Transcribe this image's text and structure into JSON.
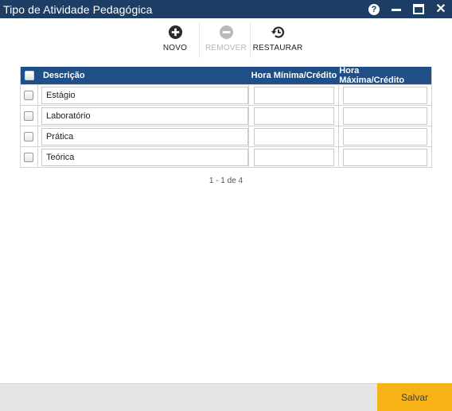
{
  "window": {
    "title": "Tipo de Atividade Pedagógica",
    "help_label": "?",
    "close_label": "✕"
  },
  "toolbar": {
    "new_label": "NOVO",
    "remove_label": "REMOVER",
    "restore_label": "RESTAURAR"
  },
  "table": {
    "headers": {
      "description": "Descrição",
      "min_hour": "Hora Mínima/Crédito",
      "max_hour": "Hora Máxima/Crédito"
    },
    "rows": [
      {
        "description": "Estágio",
        "min_hour": "",
        "max_hour": ""
      },
      {
        "description": "Laboratório",
        "min_hour": "",
        "max_hour": ""
      },
      {
        "description": "Prática",
        "min_hour": "",
        "max_hour": ""
      },
      {
        "description": "Teórica",
        "min_hour": "",
        "max_hour": ""
      }
    ]
  },
  "pager": {
    "text": "1 - 1 de 4"
  },
  "footer": {
    "save_label": "Salvar"
  },
  "colors": {
    "titlebar": "#1d3d64",
    "table_header": "#1f4f86",
    "save_button": "#f7b217"
  }
}
